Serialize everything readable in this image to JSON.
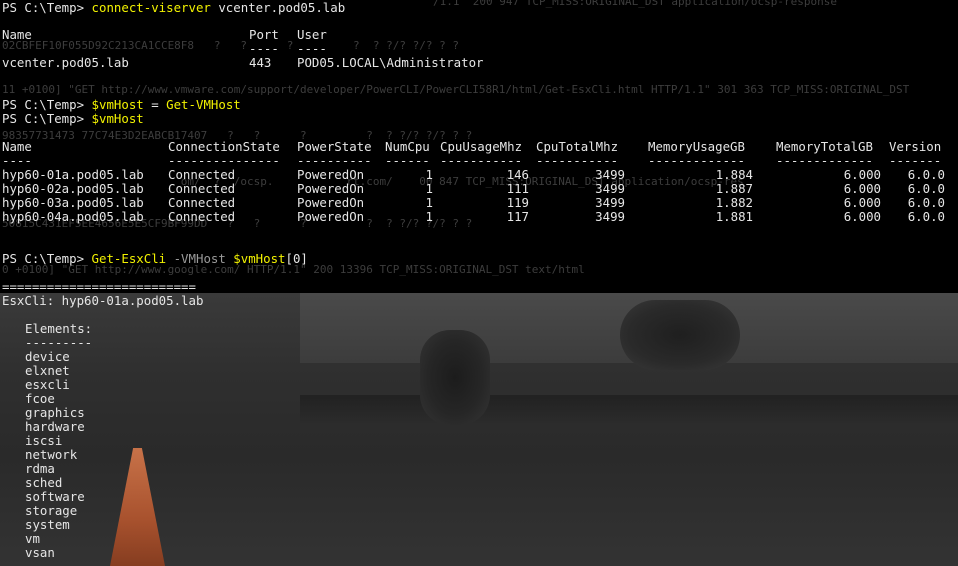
{
  "ghost_lines": [
    "02CBFEF10F055D92C213CA1CCE8F8   ?   ?      ?         ?  ? ?/? ?/? ? ?",
    "11 +0100] \"GET http://www.vmware.com/support/developer/PowerCLI/PowerCLI58R1/html/Get-EsxCli.html HTTP/1.1\" 301 363 TCP_MISS:ORIGINAL_DST",
    "98357731473 77C74E3D2EABCB17407   ?   ?      ?         ?  ? ?/? ?/? ? ?",
    "                           om/  ?  /ocsp.           rt.com/    00 847 TCP_MISS:ORIGINAL_DST application/ocsp-res",
    "50815C431EF5EE4656E5E5CF9BF99DD   ?   ?      ?         ?  ? ?/? ?/? ? ?",
    "0 +0100] \"GET http://www.google.com/ HTTP/1.1\" 200 13396 TCP_MISS:ORIGINAL_DST text/html",
    "        /1.1\" 200 947 TCP_MISS:ORIGINAL_DST application/ocsp-response"
  ],
  "cmd1": {
    "prompt": "PS C:\\Temp> ",
    "command": "connect-viserver",
    "args": " vcenter.pod05.lab"
  },
  "server": {
    "headers": {
      "name": "Name",
      "port": "Port",
      "user": "User"
    },
    "underline": {
      "port": "----",
      "user": "----"
    },
    "row": {
      "name": "vcenter.pod05.lab",
      "port": "443",
      "user": "POD05.LOCAL\\Administrator"
    }
  },
  "cmd2": {
    "prompt": "PS C:\\Temp> ",
    "var": "$vmHost",
    "op": " = ",
    "cmd": "Get-VMHost"
  },
  "cmd3": {
    "prompt": "PS C:\\Temp> ",
    "var": "$vmHost"
  },
  "hosts": {
    "headers": [
      "Name",
      "ConnectionState",
      "PowerState",
      "NumCpu",
      "CpuUsageMhz",
      "CpuTotalMhz",
      "MemoryUsageGB",
      "MemoryTotalGB",
      "Version"
    ],
    "underlines": [
      "----",
      "---------------",
      "----------",
      "------",
      "-----------",
      "-----------",
      "-------------",
      "-------------",
      "-------"
    ],
    "rows": [
      [
        "hyp60-01a.pod05.lab",
        "Connected",
        "PoweredOn",
        "1",
        "146",
        "3499",
        "1.884",
        "6.000",
        "6.0.0"
      ],
      [
        "hyp60-02a.pod05.lab",
        "Connected",
        "PoweredOn",
        "1",
        "111",
        "3499",
        "1.887",
        "6.000",
        "6.0.0"
      ],
      [
        "hyp60-03a.pod05.lab",
        "Connected",
        "PoweredOn",
        "1",
        "119",
        "3499",
        "1.882",
        "6.000",
        "6.0.0"
      ],
      [
        "hyp60-04a.pod05.lab",
        "Connected",
        "PoweredOn",
        "1",
        "117",
        "3499",
        "1.881",
        "6.000",
        "6.0.0"
      ]
    ]
  },
  "cmd4": {
    "prompt": "PS C:\\Temp> ",
    "cmd": "Get-EsxCli",
    "param": " -VMHost ",
    "var": "$vmHost",
    "index": "[0]"
  },
  "esxcli": {
    "rule": "==========================",
    "title": "EsxCli: hyp60-01a.pod05.lab",
    "elements_label": "Elements:",
    "elements_rule": "---------",
    "elements": [
      "device",
      "elxnet",
      "esxcli",
      "fcoe",
      "graphics",
      "hardware",
      "iscsi",
      "network",
      "rdma",
      "sched",
      "software",
      "storage",
      "system",
      "vm",
      "vsan"
    ]
  }
}
